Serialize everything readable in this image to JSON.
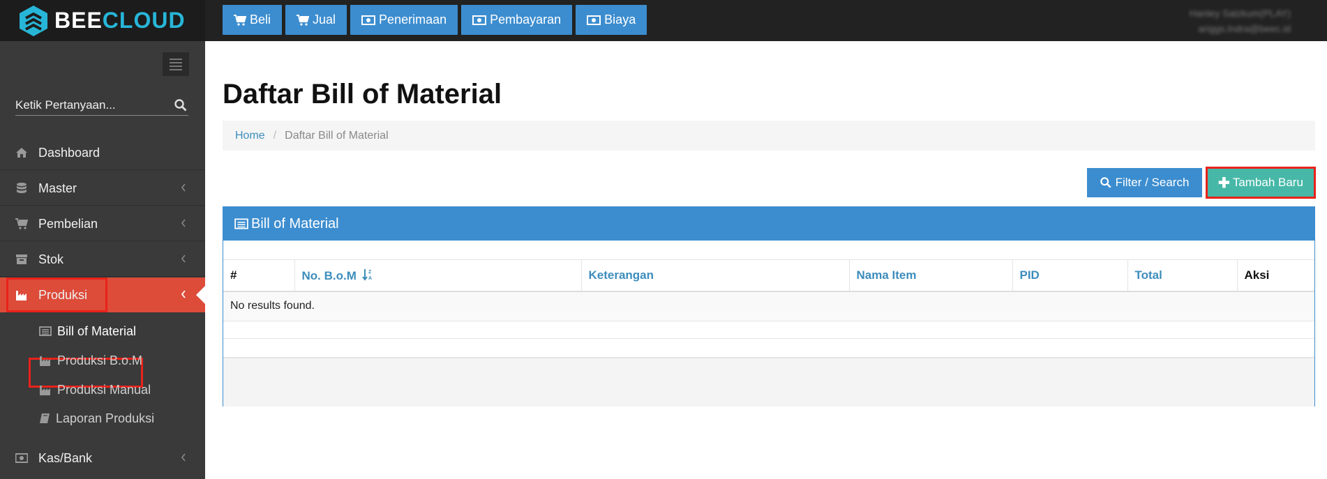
{
  "app": {
    "logo_part1": "BEE",
    "logo_part2": "CLOUD",
    "brand_color": "#27b6d8"
  },
  "topnav": [
    {
      "label": "Beli",
      "icon": "cart-icon"
    },
    {
      "label": "Jual",
      "icon": "cart-icon"
    },
    {
      "label": "Penerimaan",
      "icon": "money-icon"
    },
    {
      "label": "Pembayaran",
      "icon": "money-icon"
    },
    {
      "label": "Biaya",
      "icon": "money-icon"
    }
  ],
  "user": {
    "name": "Hanley Salzkum(PLAY)",
    "email": "ariggs.lndra@beec.id"
  },
  "sidebar": {
    "search_placeholder": "Ketik Pertanyaan...",
    "items": [
      {
        "label": "Dashboard",
        "icon": "home-icon"
      },
      {
        "label": "Master",
        "icon": "database-icon"
      },
      {
        "label": "Pembelian",
        "icon": "cart-icon"
      },
      {
        "label": "Stok",
        "icon": "archive-icon"
      },
      {
        "label": "Produksi",
        "icon": "factory-icon",
        "active": true
      },
      {
        "label": "Kas/Bank",
        "icon": "money-icon"
      }
    ],
    "sub_items": [
      {
        "label": "Bill of Material",
        "icon": "list-alt-icon"
      },
      {
        "label": "Produksi B.o.M",
        "icon": "factory-icon"
      },
      {
        "label": "Produksi Manual",
        "icon": "factory-icon"
      },
      {
        "label": "Laporan Produksi",
        "icon": "book-icon"
      }
    ]
  },
  "main": {
    "title": "Daftar Bill of Material",
    "breadcrumb": {
      "home": "Home",
      "separator": "/",
      "current": "Daftar Bill of Material"
    },
    "filter_button": "Filter / Search",
    "add_button": "Tambah Baru",
    "panel_title": "Bill of Material",
    "table": {
      "columns": [
        "#",
        "No. B.o.M",
        "Keterangan",
        "Nama Item",
        "PID",
        "Total",
        "Aksi"
      ],
      "empty_text": "No results found."
    }
  },
  "colors": {
    "primary": "#3c8dcf",
    "active_menu": "#dd4b39",
    "add_button": "#47b8a8",
    "highlight_frame": "#e8221a"
  }
}
